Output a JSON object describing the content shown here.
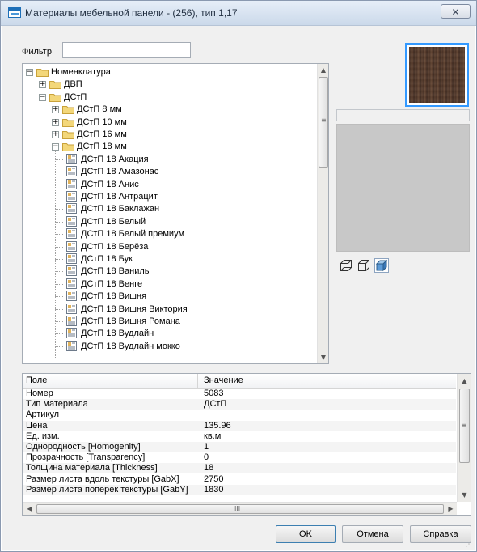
{
  "window": {
    "title": "Материалы мебельной панели -  (256), тип 1,17",
    "close_glyph": "✕"
  },
  "filter": {
    "label": "Фильтр",
    "value": ""
  },
  "tree": {
    "items": [
      {
        "label": "Номенклатура",
        "level": 0,
        "kind": "folder",
        "expander": "−"
      },
      {
        "label": "ДВП",
        "level": 1,
        "kind": "folder",
        "expander": "+"
      },
      {
        "label": "ДСтП",
        "level": 1,
        "kind": "folder",
        "expander": "−"
      },
      {
        "label": "ДСтП 8 мм",
        "level": 2,
        "kind": "folder",
        "expander": "+"
      },
      {
        "label": "ДСтП 10 мм",
        "level": 2,
        "kind": "folder",
        "expander": "+"
      },
      {
        "label": "ДСтП 16 мм",
        "level": 2,
        "kind": "folder",
        "expander": "+"
      },
      {
        "label": "ДСтП 18 мм",
        "level": 2,
        "kind": "folder",
        "expander": "−"
      },
      {
        "label": "ДСтП 18 Акация",
        "level": 3,
        "kind": "doc"
      },
      {
        "label": "ДСтП 18 Амазонас",
        "level": 3,
        "kind": "doc"
      },
      {
        "label": "ДСтП 18 Анис",
        "level": 3,
        "kind": "doc"
      },
      {
        "label": "ДСтП 18 Антрацит",
        "level": 3,
        "kind": "doc"
      },
      {
        "label": "ДСтП 18 Баклажан",
        "level": 3,
        "kind": "doc"
      },
      {
        "label": "ДСтП 18 Белый",
        "level": 3,
        "kind": "doc"
      },
      {
        "label": "ДСтП 18 Белый премиум",
        "level": 3,
        "kind": "doc"
      },
      {
        "label": "ДСтП 18 Берёза",
        "level": 3,
        "kind": "doc"
      },
      {
        "label": "ДСтП 18 Бук",
        "level": 3,
        "kind": "doc"
      },
      {
        "label": "ДСтП 18 Ваниль",
        "level": 3,
        "kind": "doc"
      },
      {
        "label": "ДСтП 18 Венге",
        "level": 3,
        "kind": "doc"
      },
      {
        "label": "ДСтП 18 Вишня",
        "level": 3,
        "kind": "doc"
      },
      {
        "label": "ДСтП 18 Вишня Виктория",
        "level": 3,
        "kind": "doc"
      },
      {
        "label": "ДСтП 18 Вишня Романа",
        "level": 3,
        "kind": "doc"
      },
      {
        "label": "ДСтП 18 Вудлайн",
        "level": 3,
        "kind": "doc"
      },
      {
        "label": "ДСтП 18 Вудлайн мокко",
        "level": 3,
        "kind": "doc"
      }
    ]
  },
  "properties": {
    "headers": {
      "field": "Поле",
      "value": "Значение"
    },
    "rows": [
      {
        "field": "Номер",
        "value": "5083"
      },
      {
        "field": "Тип материала",
        "value": "ДСтП"
      },
      {
        "field": "Артикул",
        "value": ""
      },
      {
        "field": "Цена",
        "value": "135.96"
      },
      {
        "field": "Ед. изм.",
        "value": "кв.м"
      },
      {
        "field": "Однородность [Homogenity]",
        "value": "1"
      },
      {
        "field": "Прозрачность [Transparency]",
        "value": "0"
      },
      {
        "field": "Толщина материала [Thickness]",
        "value": "18"
      },
      {
        "field": "Размер листа вдоль текстуры [GabX]",
        "value": "2750"
      },
      {
        "field": "Размер листа поперек текстуры [GabY]",
        "value": "1830"
      }
    ]
  },
  "buttons": {
    "ok": "OK",
    "cancel": "Отмена",
    "help": "Справка"
  },
  "scroll": {
    "up": "▲",
    "down": "▼",
    "left": "◀",
    "right": "▶",
    "grip_v": "≡",
    "grip_h": "III"
  },
  "icons": {
    "app": "window-icon",
    "folder": "folder-icon",
    "material": "material-document-icon",
    "view_modes": [
      "wireframe-box-icon",
      "outline-box-icon",
      "solid-box-icon"
    ]
  },
  "colors": {
    "selection_border": "#3399ff",
    "preview_bg": "#c8c8c8",
    "folder": "#f3d77a",
    "wood": "#4a3226"
  }
}
